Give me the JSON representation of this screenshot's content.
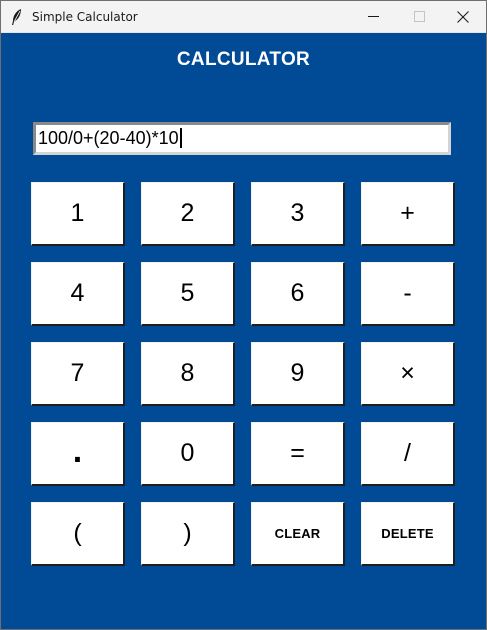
{
  "window": {
    "title": "Simple Calculator"
  },
  "heading": "CALCULATOR",
  "display": {
    "value": "100/0+(20-40)*10"
  },
  "keys": [
    {
      "label": "1",
      "name": "key-1"
    },
    {
      "label": "2",
      "name": "key-2"
    },
    {
      "label": "3",
      "name": "key-3"
    },
    {
      "label": "+",
      "name": "key-plus"
    },
    {
      "label": "4",
      "name": "key-4"
    },
    {
      "label": "5",
      "name": "key-5"
    },
    {
      "label": "6",
      "name": "key-6"
    },
    {
      "label": "-",
      "name": "key-minus"
    },
    {
      "label": "7",
      "name": "key-7"
    },
    {
      "label": "8",
      "name": "key-8"
    },
    {
      "label": "9",
      "name": "key-9"
    },
    {
      "label": "×",
      "name": "key-multiply"
    },
    {
      "label": ".",
      "name": "key-decimal"
    },
    {
      "label": "0",
      "name": "key-0"
    },
    {
      "label": "=",
      "name": "key-equals"
    },
    {
      "label": "/",
      "name": "key-divide"
    },
    {
      "label": "(",
      "name": "key-open-paren"
    },
    {
      "label": ")",
      "name": "key-close-paren"
    },
    {
      "label": "CLEAR",
      "name": "clear-button"
    },
    {
      "label": "DELETE",
      "name": "delete-button"
    }
  ],
  "icons": {
    "app": "feather-icon",
    "minimize": "minimize-icon",
    "maximize": "maximize-icon",
    "close": "close-icon"
  },
  "colors": {
    "background": "#004a96",
    "key_face": "#ffffff",
    "heading_text": "#ffffff"
  }
}
